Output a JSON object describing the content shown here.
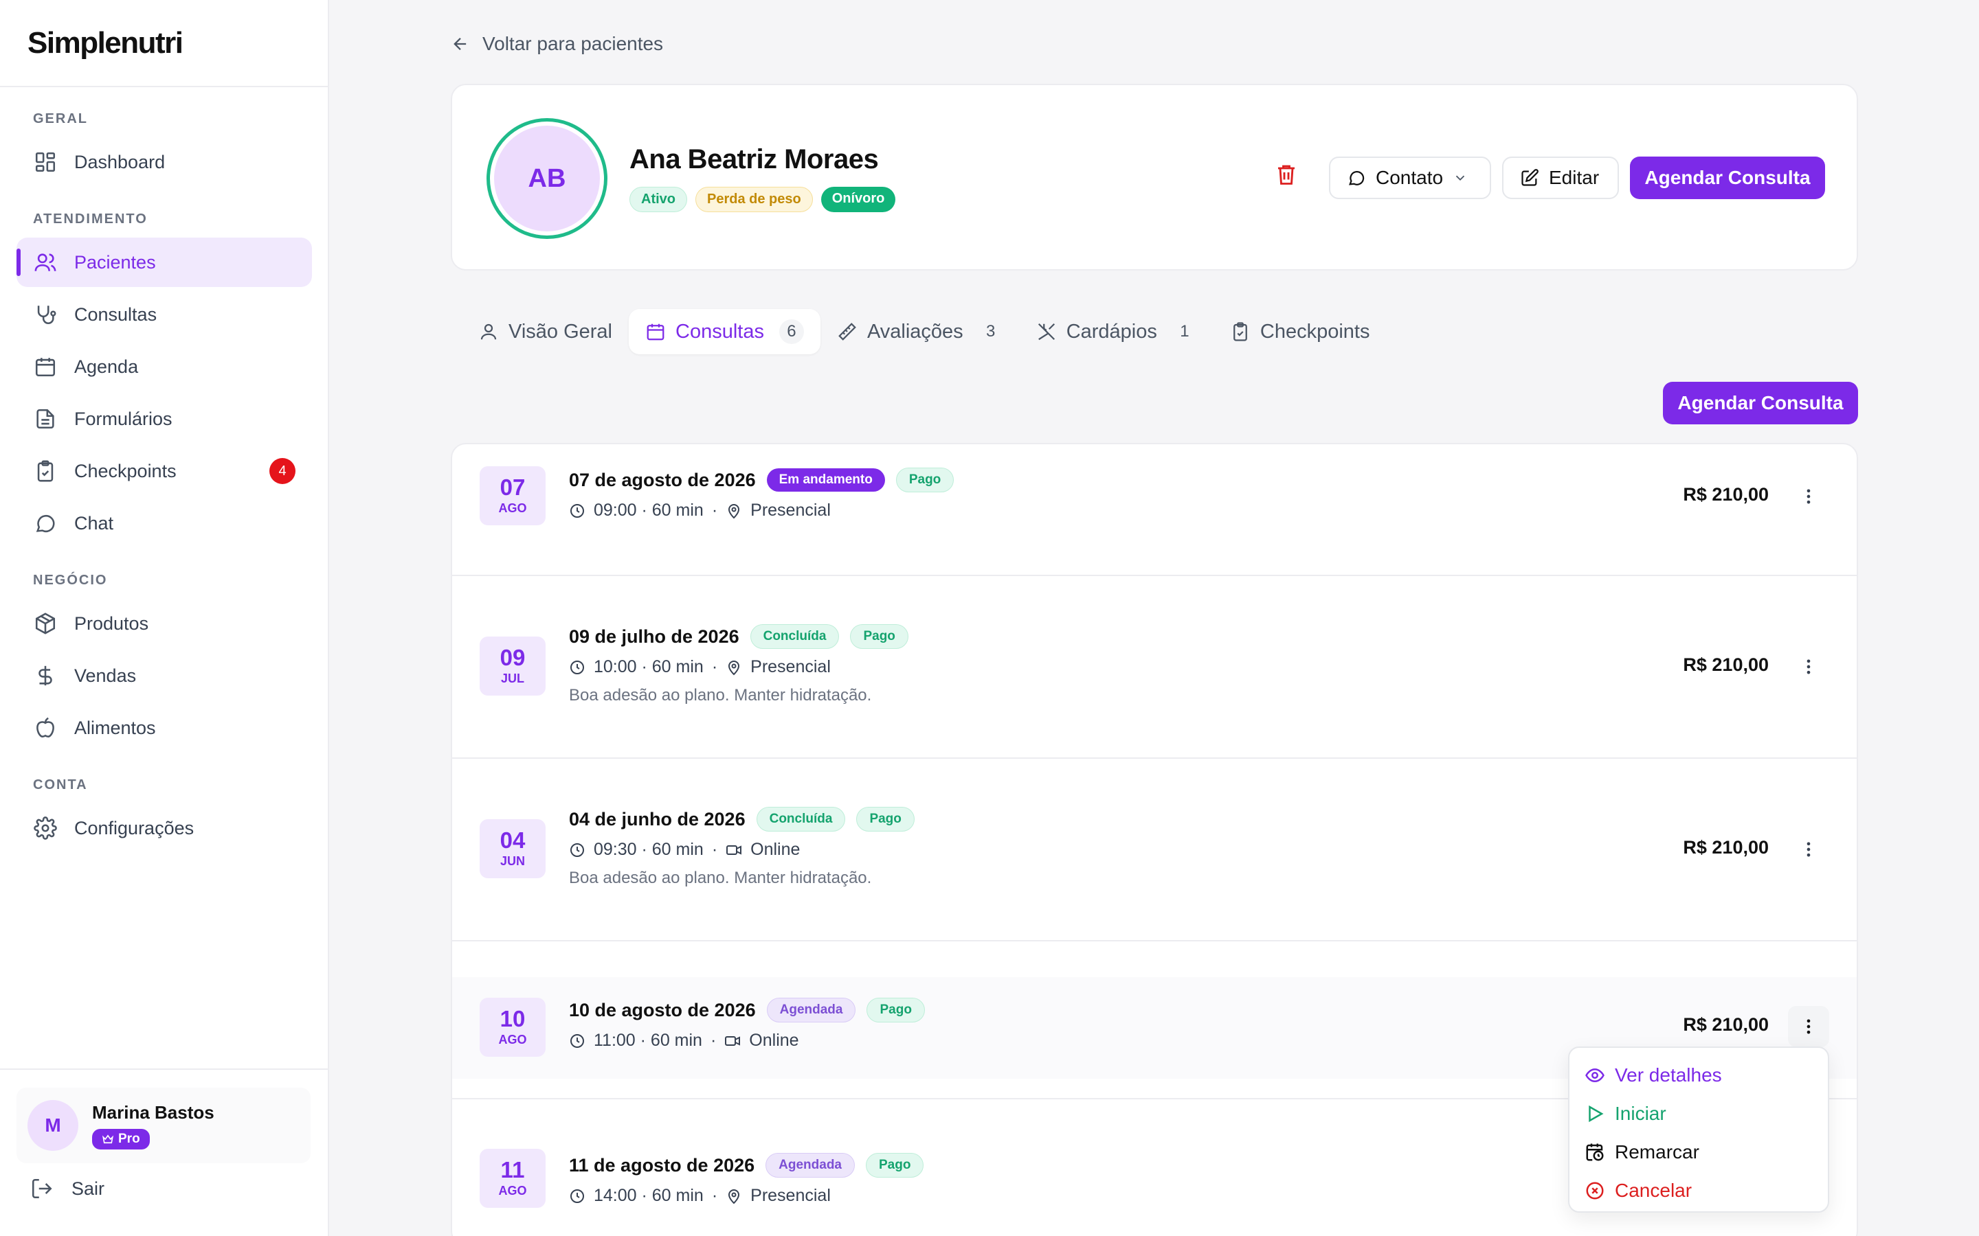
{
  "app": {
    "logo": "Simplenutri"
  },
  "sidebar": {
    "sections": [
      {
        "title": "GERAL"
      },
      {
        "title": "ATENDIMENTO"
      },
      {
        "title": "NEGÓCIO"
      },
      {
        "title": "CONTA"
      }
    ],
    "items": [
      {
        "label": "Dashboard",
        "icon": "dashboard-icon"
      },
      {
        "label": "Pacientes",
        "icon": "users-icon",
        "active": true
      },
      {
        "label": "Consultas",
        "icon": "stethoscope-icon"
      },
      {
        "label": "Agenda",
        "icon": "calendar-icon"
      },
      {
        "label": "Formulários",
        "icon": "document-icon"
      },
      {
        "label": "Checkpoints",
        "icon": "clipboard-check-icon",
        "badge": "4"
      },
      {
        "label": "Chat",
        "icon": "chat-icon"
      },
      {
        "label": "Produtos",
        "icon": "package-icon"
      },
      {
        "label": "Vendas",
        "icon": "dollar-icon"
      },
      {
        "label": "Alimentos",
        "icon": "apple-icon"
      },
      {
        "label": "Configurações",
        "icon": "gear-icon"
      }
    ],
    "user": {
      "initial": "M",
      "name": "Marina Bastos",
      "plan": "Pro"
    },
    "logout_label": "Sair"
  },
  "header": {
    "back_label": "Voltar para pacientes"
  },
  "patient": {
    "initials": "AB",
    "name": "Ana Beatriz Moraes",
    "tags": [
      "Ativo",
      "Perda de peso",
      "Onívoro"
    ],
    "contact_label": "Contato",
    "edit_label": "Editar",
    "schedule_label": "Agendar Consulta"
  },
  "tabs": [
    {
      "label": "Visão Geral",
      "count": ""
    },
    {
      "label": "Consultas",
      "count": "6",
      "active": true
    },
    {
      "label": "Avaliações",
      "count": "3"
    },
    {
      "label": "Cardápios",
      "count": "1"
    },
    {
      "label": "Checkpoints",
      "count": ""
    }
  ],
  "schedule_button_label": "Agendar Consulta",
  "consultations": [
    {
      "day": "07",
      "month": "AGO",
      "date": "07 de agosto de 2026",
      "status": "Em andamento",
      "payment": "Pago",
      "time": "09:00 · 60 min",
      "mode": "Presencial",
      "note": "",
      "price": "R$ 210,00"
    },
    {
      "day": "09",
      "month": "JUL",
      "date": "09 de julho de 2026",
      "status": "Concluída",
      "payment": "Pago",
      "time": "10:00 · 60 min",
      "mode": "Presencial",
      "note": "Boa adesão ao plano. Manter hidratação.",
      "price": "R$ 210,00"
    },
    {
      "day": "04",
      "month": "JUN",
      "date": "04 de junho de 2026",
      "status": "Concluída",
      "payment": "Pago",
      "time": "09:30 · 60 min",
      "mode": "Online",
      "note": "Boa adesão ao plano. Manter hidratação.",
      "price": "R$ 210,00"
    },
    {
      "day": "10",
      "month": "AGO",
      "date": "10 de agosto de 2026",
      "status": "Agendada",
      "payment": "Pago",
      "time": "11:00 · 60 min",
      "mode": "Online",
      "note": "",
      "price": "R$ 210,00"
    },
    {
      "day": "11",
      "month": "AGO",
      "date": "11 de agosto de 2026",
      "status": "Agendada",
      "payment": "Pago",
      "time": "14:00 · 60 min",
      "mode": "Presencial",
      "note": "",
      "price": ""
    }
  ],
  "row_menu": {
    "items": [
      {
        "label": "Ver detalhes",
        "icon": "eye-icon"
      },
      {
        "label": "Iniciar",
        "icon": "play-icon"
      },
      {
        "label": "Remarcar",
        "icon": "calendar-clock-icon"
      },
      {
        "label": "Cancelar",
        "icon": "x-circle-icon"
      }
    ]
  },
  "colors": {
    "accent": "#7c2ae8",
    "success": "#11b47a",
    "danger": "#dc1f1f",
    "warning": "#c28a06"
  }
}
